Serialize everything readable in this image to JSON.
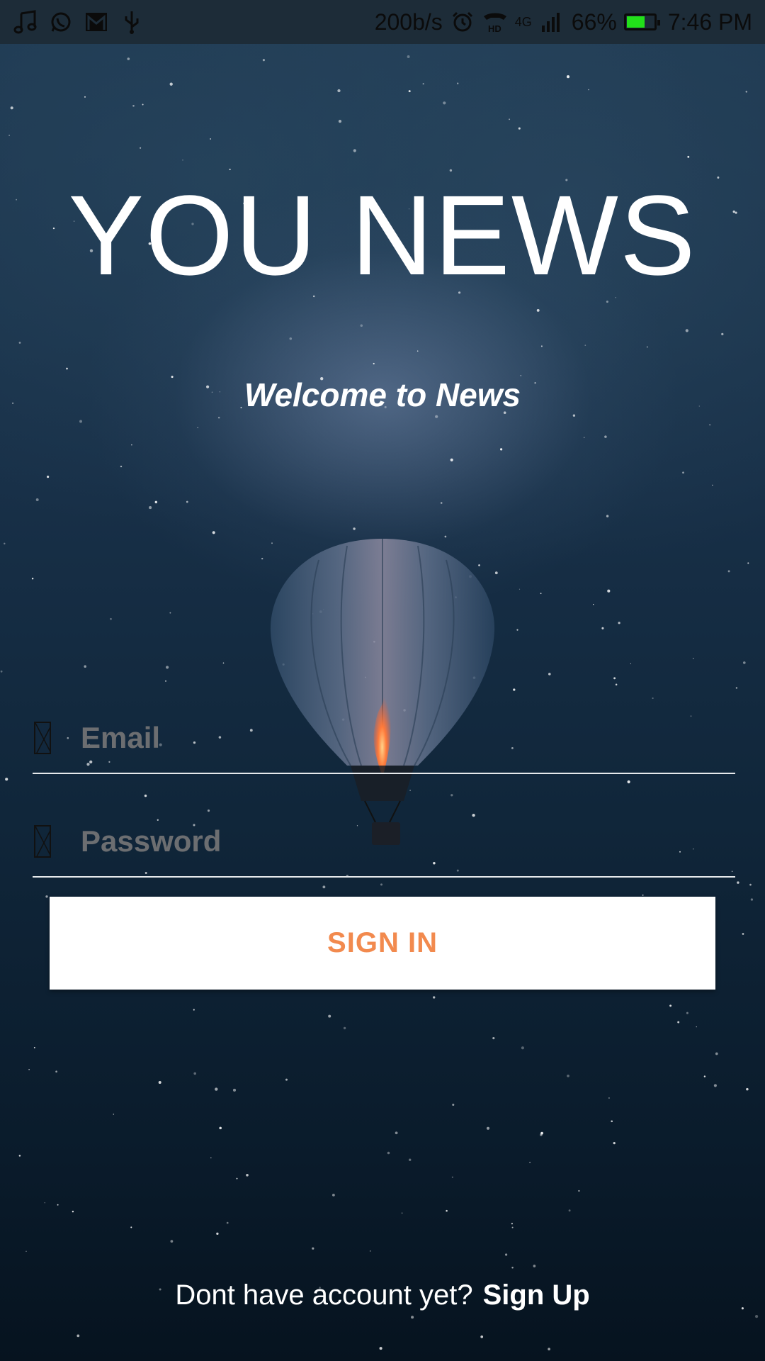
{
  "status_bar": {
    "left_icons": [
      "music-note-icon",
      "whatsapp-icon",
      "gmail-icon",
      "usb-icon"
    ],
    "net_speed": "200b/s",
    "network_label": "4G",
    "battery_percent": "66%",
    "battery_level": 0.66,
    "time": "7:46 PM",
    "battery_color": "#22e01a"
  },
  "header": {
    "title": "YOU NEWS",
    "subtitle": "Welcome to News"
  },
  "form": {
    "email_placeholder": "Email",
    "password_placeholder": "Password",
    "signin_label": "SIGN IN",
    "signin_color": "#f28a4e"
  },
  "footer": {
    "prompt": "Dont have account yet?",
    "signup_label": "Sign Up"
  }
}
